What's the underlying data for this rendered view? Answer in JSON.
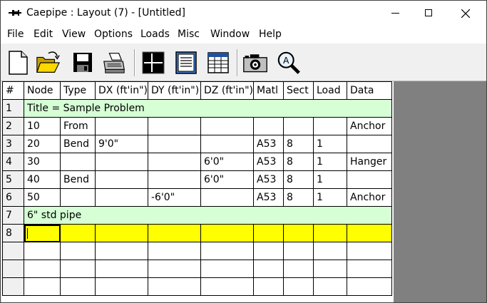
{
  "window": {
    "title": "Caepipe : Layout  (7)  -  [Untitled]"
  },
  "menu": [
    "File",
    "Edit",
    "View",
    "Options",
    "Loads",
    "Misc",
    "Window",
    "Help"
  ],
  "toolbar": {
    "buttons": [
      "new-file-icon",
      "open-folder-icon",
      "save-disk-icon",
      "print-icon",
      "layout-grid-icon",
      "text-report-icon",
      "table-view-icon",
      "camera-icon",
      "zoom-magnifier-icon"
    ]
  },
  "grid": {
    "headers": [
      "#",
      "Node",
      "Type",
      "DX (ft'in\")",
      "DY (ft'in\")",
      "DZ (ft'in\")",
      "Matl",
      "Sect",
      "Load",
      "Data"
    ],
    "rows": [
      {
        "num": "1",
        "span": "Title = Sample Problem"
      },
      {
        "num": "2",
        "cells": [
          "10",
          "From",
          "",
          "",
          "",
          "",
          "",
          "",
          "Anchor"
        ]
      },
      {
        "num": "3",
        "cells": [
          "20",
          "Bend",
          "9'0\"",
          "",
          "",
          "A53",
          "8",
          "1",
          ""
        ]
      },
      {
        "num": "4",
        "cells": [
          "30",
          "",
          "",
          "",
          "6'0\"",
          "A53",
          "8",
          "1",
          "Hanger"
        ]
      },
      {
        "num": "5",
        "cells": [
          "40",
          "Bend",
          "",
          "",
          "6'0\"",
          "A53",
          "8",
          "1",
          ""
        ]
      },
      {
        "num": "6",
        "cells": [
          "50",
          "",
          "",
          "-6'0\"",
          "",
          "A53",
          "8",
          "1",
          "Anchor"
        ]
      },
      {
        "num": "7",
        "span": "6\" std pipe"
      },
      {
        "num": "8",
        "cells": [
          "",
          "",
          "",
          "",
          "",
          "",
          "",
          "",
          ""
        ]
      }
    ]
  },
  "colors": {
    "comment_row": "#d6ffd6",
    "current_row": "#ffff00",
    "background_area": "#808080"
  }
}
